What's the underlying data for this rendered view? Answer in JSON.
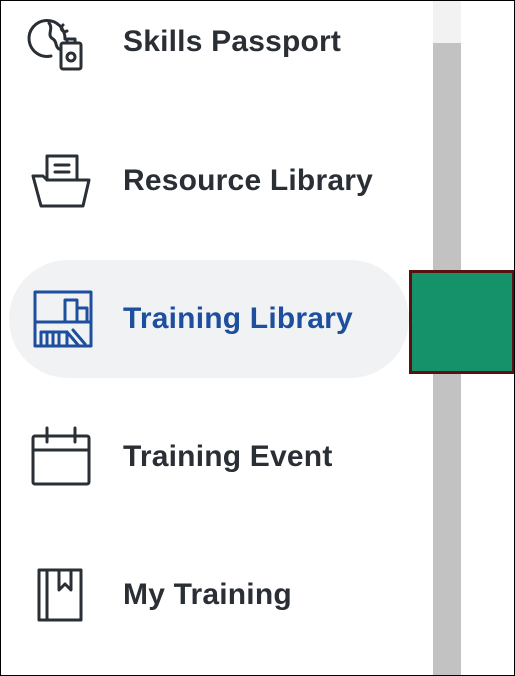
{
  "sidebar": {
    "items": [
      {
        "label": "Skills Passport",
        "icon": "skills-passport-icon",
        "active": false
      },
      {
        "label": "Resource Library",
        "icon": "folder-document-icon",
        "active": false
      },
      {
        "label": "Training Library",
        "icon": "library-shelf-icon",
        "active": true
      },
      {
        "label": "Training Event",
        "icon": "calendar-icon",
        "active": false
      },
      {
        "label": "My Training",
        "icon": "bookmark-book-icon",
        "active": false
      }
    ]
  },
  "colors": {
    "active_text": "#1d4f9e",
    "default_text": "#2a2f36",
    "active_background": "#f1f2f4",
    "highlight_fill": "#16926a",
    "highlight_border": "#5a1010"
  }
}
